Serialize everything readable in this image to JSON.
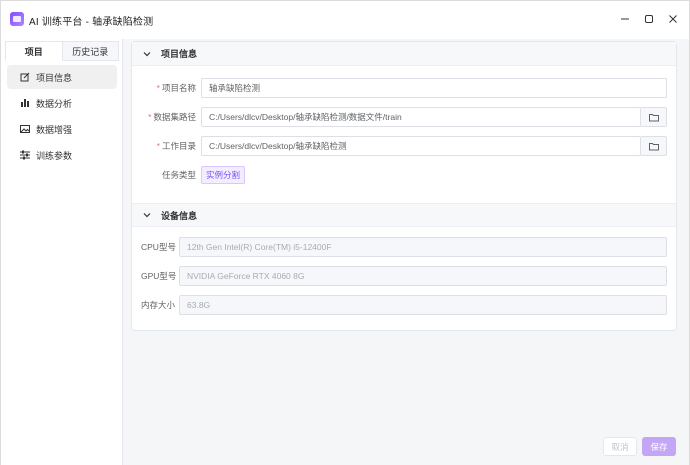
{
  "window": {
    "title": "AI 训练平台 - 轴承缺陷检测"
  },
  "sidebar": {
    "tabs": [
      {
        "label": "项目",
        "active": true
      },
      {
        "label": "历史记录",
        "active": false
      }
    ],
    "items": [
      {
        "label": "项目信息",
        "icon": "edit-icon",
        "active": true
      },
      {
        "label": "数据分析",
        "icon": "bar-chart-icon",
        "active": false
      },
      {
        "label": "数据增强",
        "icon": "image-icon",
        "active": false
      },
      {
        "label": "训练参数",
        "icon": "sliders-icon",
        "active": false
      }
    ]
  },
  "project_section": {
    "title": "项目信息",
    "name_label": "项目名称",
    "name_value": "轴承缺陷检测",
    "dataset_label": "数据集路径",
    "dataset_value": "C:/Users/dlcv/Desktop/轴承缺陷检测/数据文件/train",
    "workdir_label": "工作目录",
    "workdir_value": "C:/Users/dlcv/Desktop/轴承缺陷检测",
    "task_label": "任务类型",
    "task_value": "实例分割"
  },
  "device_section": {
    "title": "设备信息",
    "cpu_label": "CPU型号",
    "cpu_value": "12th Gen Intel(R) Core(TM) i5-12400F",
    "gpu_label": "GPU型号",
    "gpu_value": "NVIDIA GeForce RTX 4060 8G",
    "mem_label": "内存大小",
    "mem_value": "63.8G"
  },
  "footer": {
    "cancel_label": "取消",
    "save_label": "保存"
  },
  "colors": {
    "accent": "#7c4dff",
    "save_button": "#c3a6f5",
    "required": "#f56c6c"
  }
}
